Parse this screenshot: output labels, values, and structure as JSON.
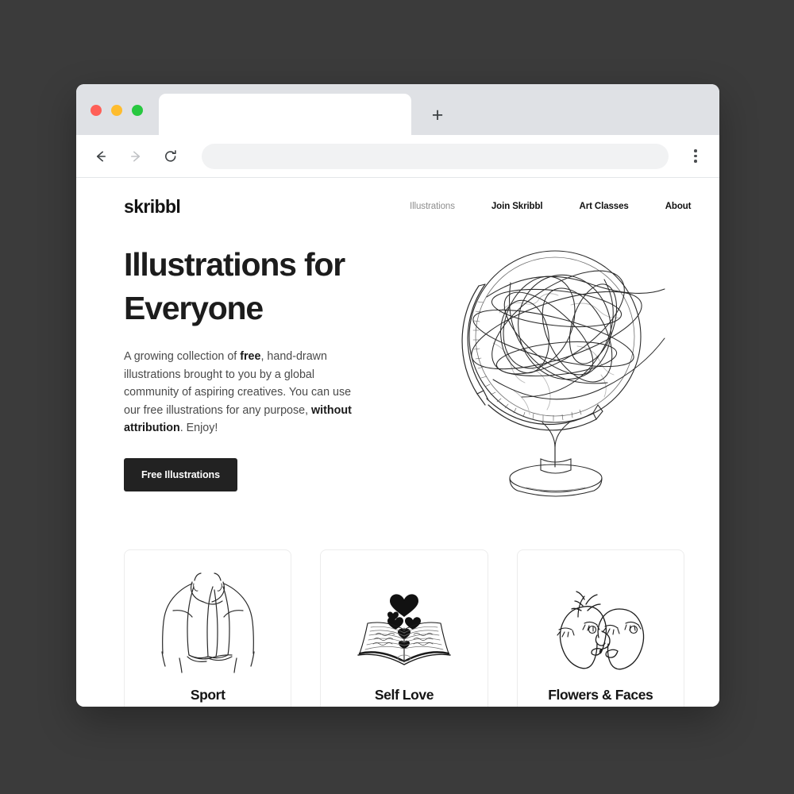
{
  "browser": {
    "window_controls": [
      {
        "name": "close",
        "color": "#ff5f57"
      },
      {
        "name": "minimize",
        "color": "#febc2e"
      },
      {
        "name": "maximize",
        "color": "#28c840"
      }
    ],
    "tab": {
      "title": ""
    },
    "new_tab_label": "+",
    "toolbar": {
      "back_icon": "arrow-left",
      "forward_icon": "arrow-right",
      "reload_icon": "reload",
      "menu_icon": "kebab-menu",
      "url_value": "",
      "url_placeholder": ""
    }
  },
  "site": {
    "logo": "skribbl",
    "nav": [
      {
        "label": "Illustrations",
        "active": true
      },
      {
        "label": "Join Skribbl",
        "active": false
      },
      {
        "label": "Art Classes",
        "active": false
      },
      {
        "label": "About",
        "active": false
      }
    ],
    "hero": {
      "title_line1": "Illustrations for",
      "title_line2": "Everyone",
      "paragraph_part1": "A growing collection of ",
      "paragraph_bold1": "free",
      "paragraph_part2": ", hand-drawn illustrations brought to you by a global community of aspiring creatives. You can use our free illustrations for any purpose, ",
      "paragraph_bold2": "without attribution",
      "paragraph_part3": ". Enjoy!",
      "cta_label": "Free Illustrations",
      "art_name": "globe-illustration"
    },
    "cards": [
      {
        "title": "Sport",
        "art_name": "towel-torso-illustration"
      },
      {
        "title": "Self Love",
        "art_name": "open-book-hearts-illustration"
      },
      {
        "title": "Flowers & Faces",
        "art_name": "two-faces-illustration"
      }
    ]
  },
  "colors": {
    "backdrop": "#3b3b3b",
    "tabstrip": "#dfe1e5",
    "omnibox": "#f1f2f3",
    "text_dark": "#1c1c1c",
    "text_muted": "#8e8e8e",
    "cta_bg": "#222222"
  }
}
